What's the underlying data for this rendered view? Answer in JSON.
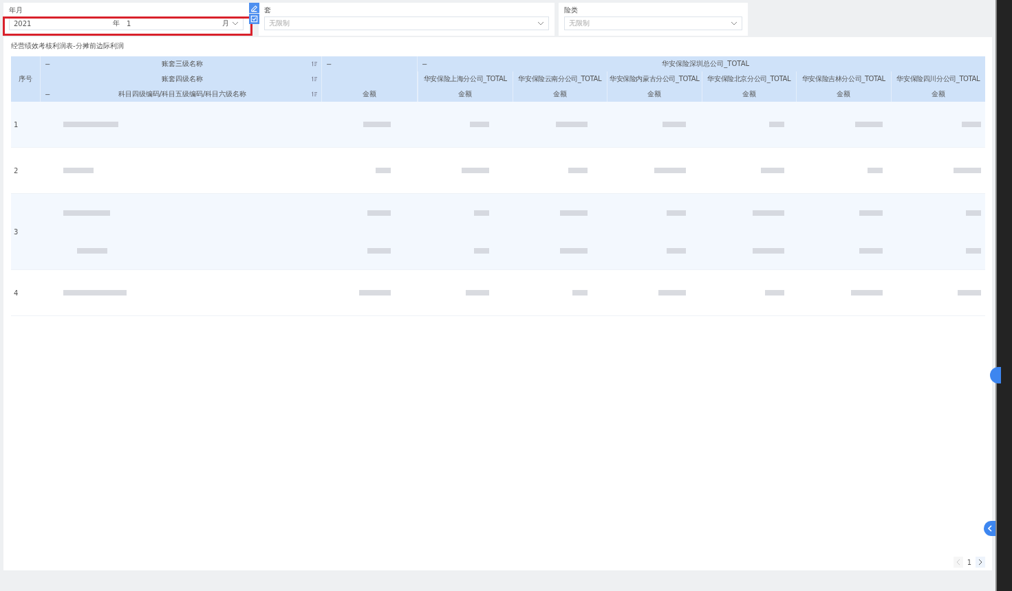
{
  "filters": [
    {
      "kind": "month",
      "label": "年月",
      "year": "2021",
      "year_unit": "年",
      "month": "1",
      "month_unit": "月",
      "highlighted": true
    },
    {
      "kind": "select",
      "label": "套",
      "placeholder": "无限制",
      "highlighted": false
    },
    {
      "kind": "select",
      "label": "险类",
      "placeholder": "无限制",
      "highlighted": false
    }
  ],
  "report_title": "经营绩效考核利润表-分摊前边际利润",
  "table": {
    "index_header": "序号",
    "dim_headers": [
      {
        "label": "账套三级名称",
        "collapse": "−"
      },
      {
        "label": "账套四级名称"
      },
      {
        "label": "科目四级编码/科目五级编码/科目六级名称",
        "collapse": "−"
      }
    ],
    "top_group": {
      "collapse_left": "−",
      "collapse_right": "−",
      "label": "华安保险深圳总公司_TOTAL"
    },
    "total_measure": "金额",
    "branches": [
      {
        "label": "华安保险上海分公司_TOTAL",
        "measure": "金额"
      },
      {
        "label": "华安保险云南分公司_TOTAL",
        "measure": "金额"
      },
      {
        "label": "华安保险内蒙古分公司_TOTAL",
        "measure": "金额"
      },
      {
        "label": "华安保险北京分公司_TOTAL",
        "measure": "金额"
      },
      {
        "label": "华安保险吉林分公司_TOTAL",
        "measure": "金额"
      },
      {
        "label": "华安保险四川分公司_TOTAL",
        "measure": "金额"
      }
    ],
    "rows": [
      {
        "index": "1",
        "kind": "single"
      },
      {
        "index": "2",
        "kind": "single"
      },
      {
        "index": "3",
        "kind": "double"
      },
      {
        "index": "4",
        "kind": "single"
      }
    ]
  },
  "pagination": {
    "page": "1",
    "prev_disabled": true
  }
}
